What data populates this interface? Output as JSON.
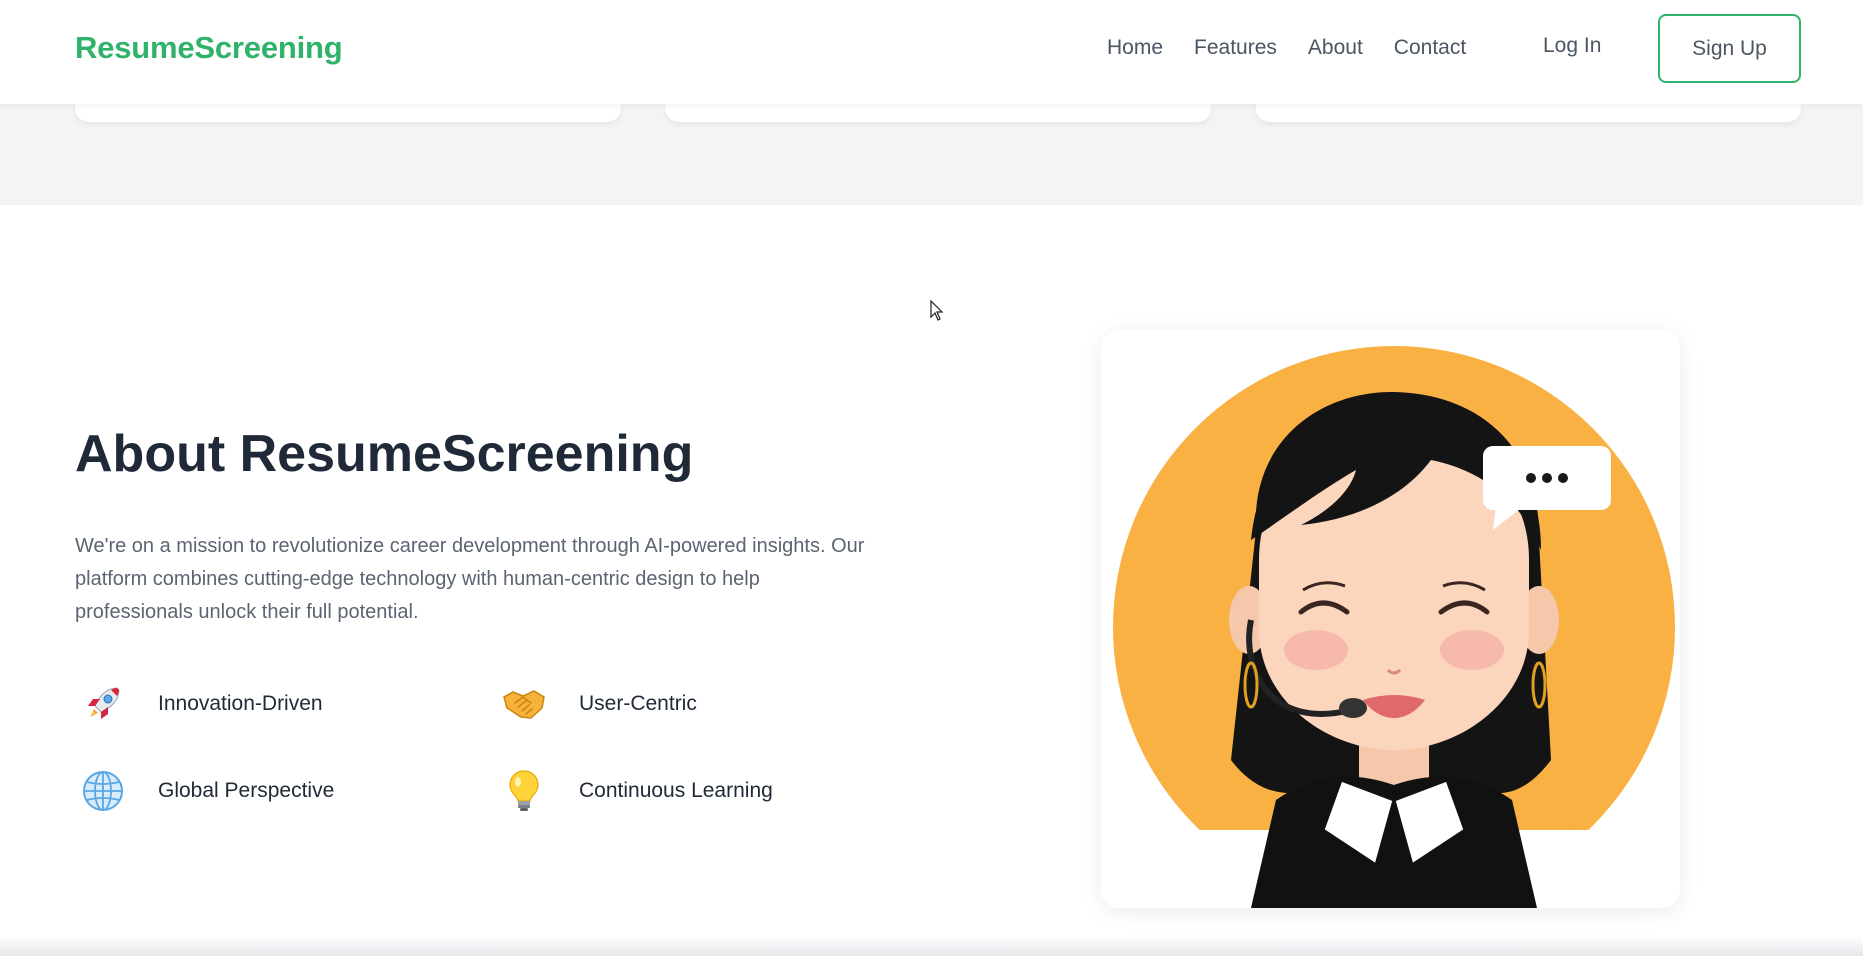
{
  "header": {
    "logo": "ResumeScreening",
    "nav": [
      "Home",
      "Features",
      "About",
      "Contact"
    ],
    "login_label": "Log In",
    "signup_label": "Sign Up"
  },
  "about": {
    "title": "About ResumeScreening",
    "description": "We're on a mission to revolutionize career development through AI-powered insights. Our platform combines cutting-edge technology with human-centric design to help professionals unlock their full potential.",
    "features": [
      {
        "label": "Innovation-Driven",
        "icon": "rocket-icon"
      },
      {
        "label": "User-Centric",
        "icon": "handshake-icon"
      },
      {
        "label": "Global Perspective",
        "icon": "globe-icon"
      },
      {
        "label": "Continuous Learning",
        "icon": "lightbulb-icon"
      }
    ]
  },
  "colors": {
    "brand_green": "#2fb36a",
    "illustration_orange": "#f9b143",
    "band_gray": "#f3f4f6",
    "title_dark": "#1f2937"
  }
}
